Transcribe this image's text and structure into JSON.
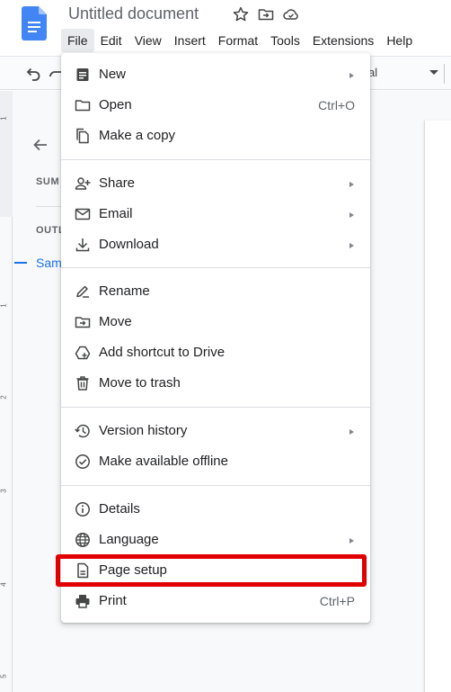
{
  "app": {
    "title": "Untitled document",
    "logo_icon": "docs-logo-icon",
    "brand_color": "#4285f4",
    "title_icons": [
      "star-icon",
      "move-to-folder-icon",
      "cloud-saved-icon"
    ]
  },
  "menubar": {
    "items": [
      "File",
      "Edit",
      "View",
      "Insert",
      "Format",
      "Tools",
      "Extensions",
      "Help"
    ],
    "active": "File"
  },
  "toolbar": {
    "style_label": "al",
    "icons": [
      "undo-icon",
      "redo-icon",
      "dropdown-caret-icon"
    ]
  },
  "outline": {
    "summary_label": "SUM",
    "outline_label": "OUTL",
    "item_label": "Sam",
    "accent_color": "#1a73e8"
  },
  "ruler": {
    "numbers": [
      "1",
      "1",
      "2",
      "3",
      "4",
      "5"
    ]
  },
  "file_menu": {
    "items": [
      {
        "label": "New",
        "icon": "document-icon",
        "submenu": true
      },
      {
        "label": "Open",
        "icon": "folder-icon",
        "shortcut": "Ctrl+O"
      },
      {
        "label": "Make a copy",
        "icon": "copy-icon"
      },
      {
        "label": "Share",
        "icon": "share-person-icon",
        "submenu": true
      },
      {
        "label": "Email",
        "icon": "email-icon",
        "submenu": true
      },
      {
        "label": "Download",
        "icon": "download-icon",
        "submenu": true
      },
      {
        "label": "Rename",
        "icon": "rename-icon"
      },
      {
        "label": "Move",
        "icon": "move-folder-icon"
      },
      {
        "label": "Add shortcut to Drive",
        "icon": "drive-shortcut-icon"
      },
      {
        "label": "Move to trash",
        "icon": "trash-icon"
      },
      {
        "label": "Version history",
        "icon": "history-icon",
        "submenu": true
      },
      {
        "label": "Make available offline",
        "icon": "offline-icon"
      },
      {
        "label": "Details",
        "icon": "info-icon"
      },
      {
        "label": "Language",
        "icon": "globe-icon",
        "submenu": true
      },
      {
        "label": "Page setup",
        "icon": "page-setup-icon",
        "highlighted": true
      },
      {
        "label": "Print",
        "icon": "print-icon",
        "shortcut": "Ctrl+P"
      }
    ],
    "highlight_color": "#e00000"
  }
}
